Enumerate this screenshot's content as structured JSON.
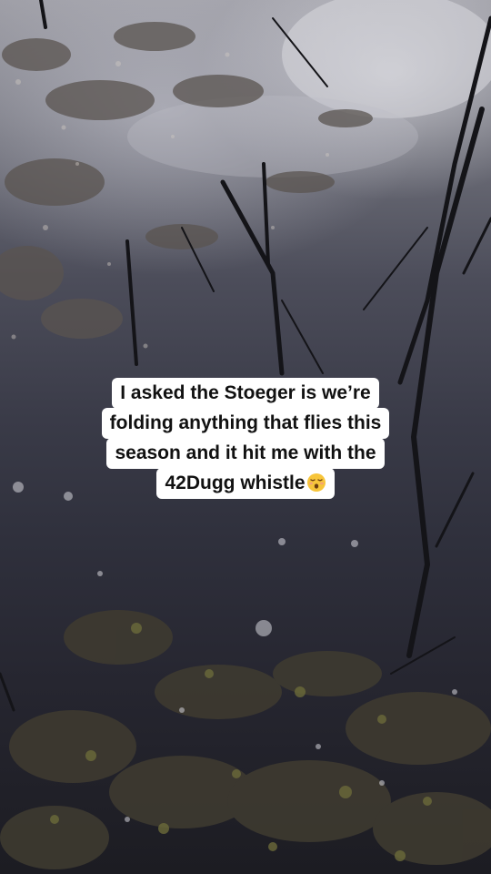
{
  "caption": {
    "lines": [
      "I asked the Stoeger is we’re",
      "folding anything that flies this",
      "season and it hit me with the",
      "42Dugg whistle"
    ],
    "emoji": "face-exhaling-emoji"
  }
}
